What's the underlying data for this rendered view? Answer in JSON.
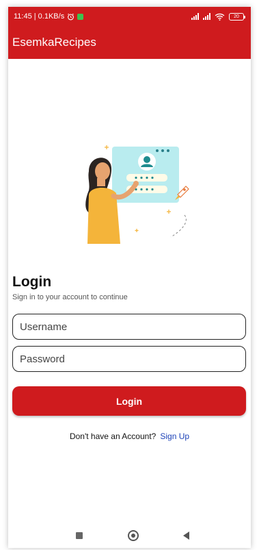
{
  "status_bar": {
    "time_speed": "11:45 | 0.1KB/s",
    "battery": "20"
  },
  "app_bar": {
    "title": "EsemkaRecipes"
  },
  "login": {
    "title": "Login",
    "subtitle": "Sign in to your account to continue",
    "username_placeholder": "Username",
    "password_placeholder": "Password",
    "button_label": "Login",
    "signup_prompt": "Don't have an Account?",
    "signup_link": "Sign Up"
  },
  "colors": {
    "brand": "#cf1b1e",
    "link": "#1e43b8"
  },
  "icons": [
    "alarm-icon",
    "notification-icon",
    "signal-icon",
    "wifi-icon",
    "battery-icon",
    "recents-icon",
    "home-icon",
    "back-icon"
  ]
}
